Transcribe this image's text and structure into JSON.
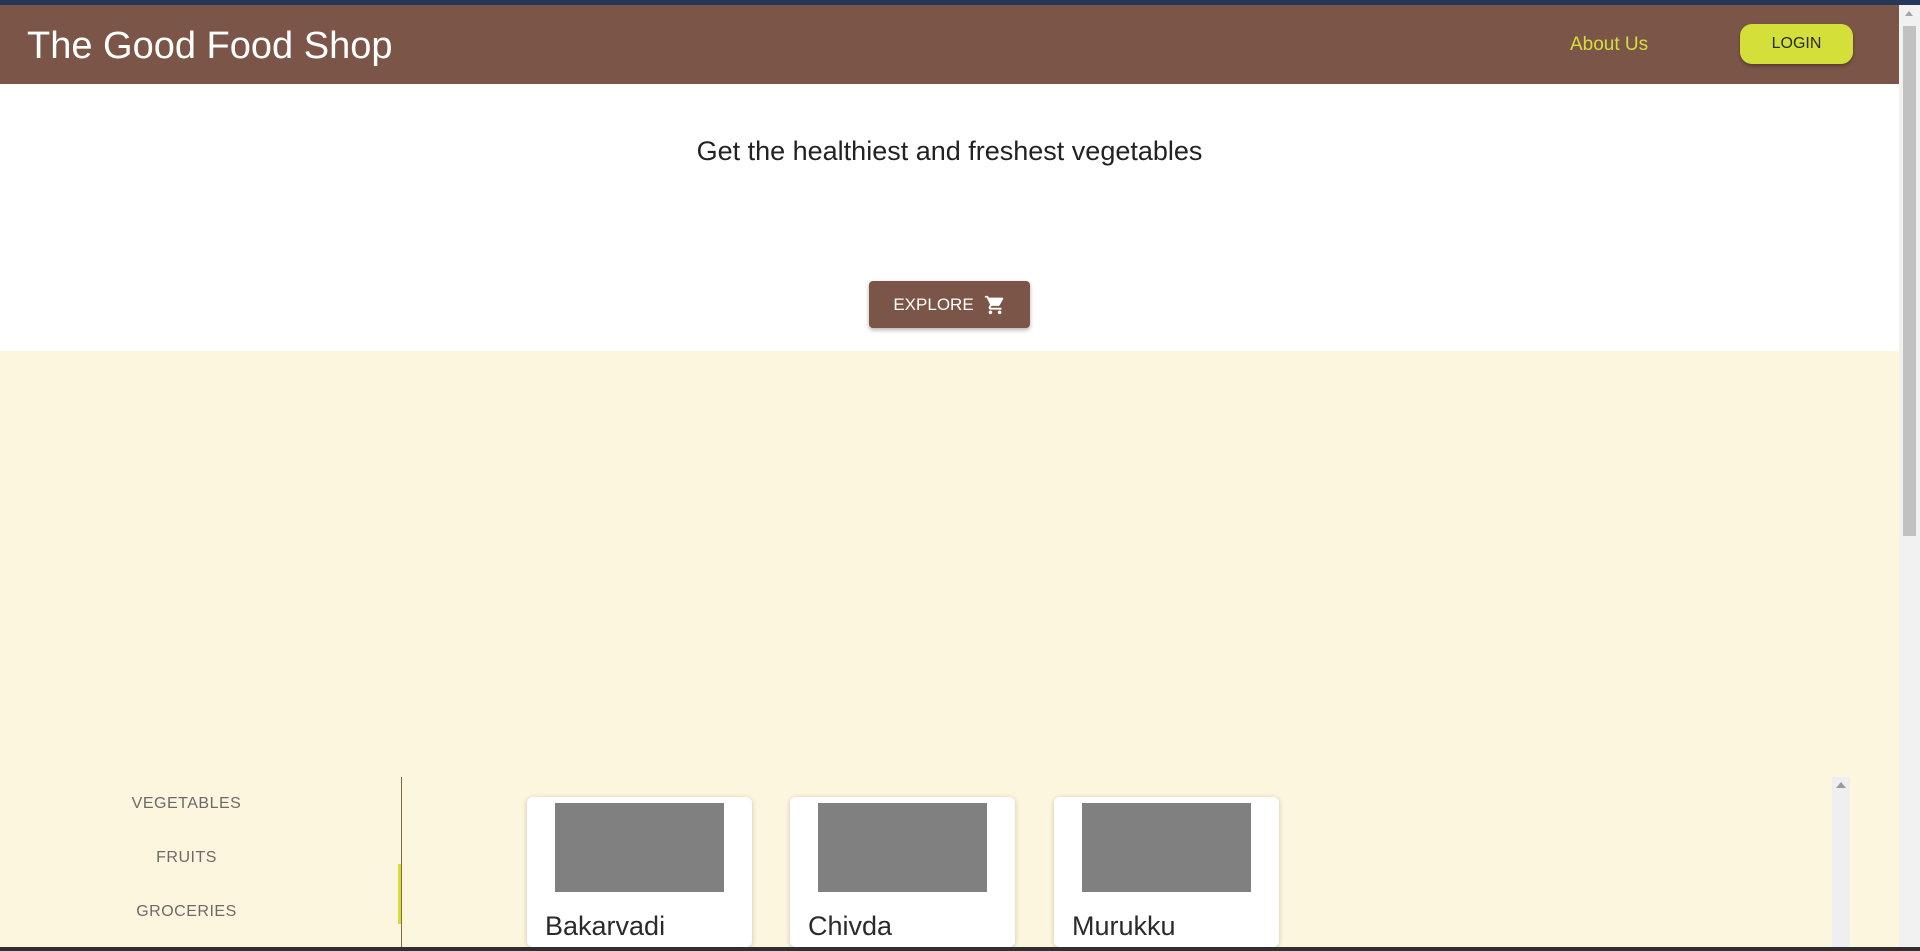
{
  "header": {
    "brand": "The Good Food Shop",
    "about_label": "About Us",
    "login_label": "LOGIN"
  },
  "hero": {
    "headline": "Get the healthiest and freshest vegetables",
    "explore_label": "EXPLORE",
    "explore_icon": "shopping-cart-icon"
  },
  "categories": [
    {
      "label": "VEGETABLES"
    },
    {
      "label": "FRUITS"
    },
    {
      "label": "GROCERIES"
    }
  ],
  "products": [
    {
      "name": "Bakarvadi"
    },
    {
      "name": "Chivda"
    },
    {
      "name": "Murukku"
    }
  ],
  "colors": {
    "brand_brown": "#7b5547",
    "accent_lime": "#d4df3a",
    "band_cream": "#fdf6de"
  }
}
